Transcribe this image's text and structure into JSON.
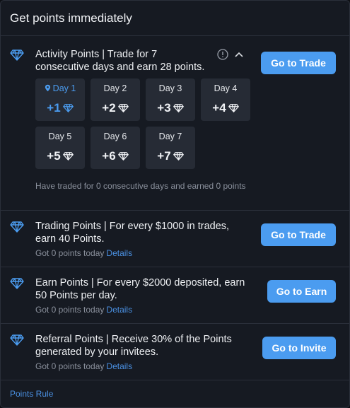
{
  "header": {
    "title": "Get points immediately"
  },
  "activity": {
    "title": "Activity Points | Trade for 7 consecutive days and earn 28 points.",
    "button": "Go to Trade",
    "status": "Have traded for 0 consecutive days and earned 0 points",
    "days": [
      {
        "label": "Day 1",
        "value": "+1"
      },
      {
        "label": "Day 2",
        "value": "+2"
      },
      {
        "label": "Day 3",
        "value": "+3"
      },
      {
        "label": "Day 4",
        "value": "+4"
      },
      {
        "label": "Day 5",
        "value": "+5"
      },
      {
        "label": "Day 6",
        "value": "+6"
      },
      {
        "label": "Day 7",
        "value": "+7"
      }
    ],
    "active_day": 1
  },
  "trading": {
    "title": "Trading Points | For every $1000 in trades, earn 40 Points.",
    "sub": "Got 0 points today",
    "link": "Details",
    "button": "Go to Trade"
  },
  "earn": {
    "title": "Earn Points | For every $2000 deposited, earn 50 Points per day.",
    "sub": "Got 0 points today",
    "link": "Details",
    "button": "Go to Earn"
  },
  "referral": {
    "title": "Referral Points | Receive 30% of the Points generated by your invitees.",
    "sub": "Got 0 points today",
    "link": "Details",
    "button": "Go to Invite"
  },
  "footer": {
    "link": "Points Rule"
  },
  "colors": {
    "accent": "#4b9cf0",
    "link": "#4a90e2",
    "panel": "#161a22",
    "tile": "#262b35"
  },
  "icons": [
    "diamond-icon",
    "info-icon",
    "chevron-up-icon",
    "location-pin-icon"
  ]
}
